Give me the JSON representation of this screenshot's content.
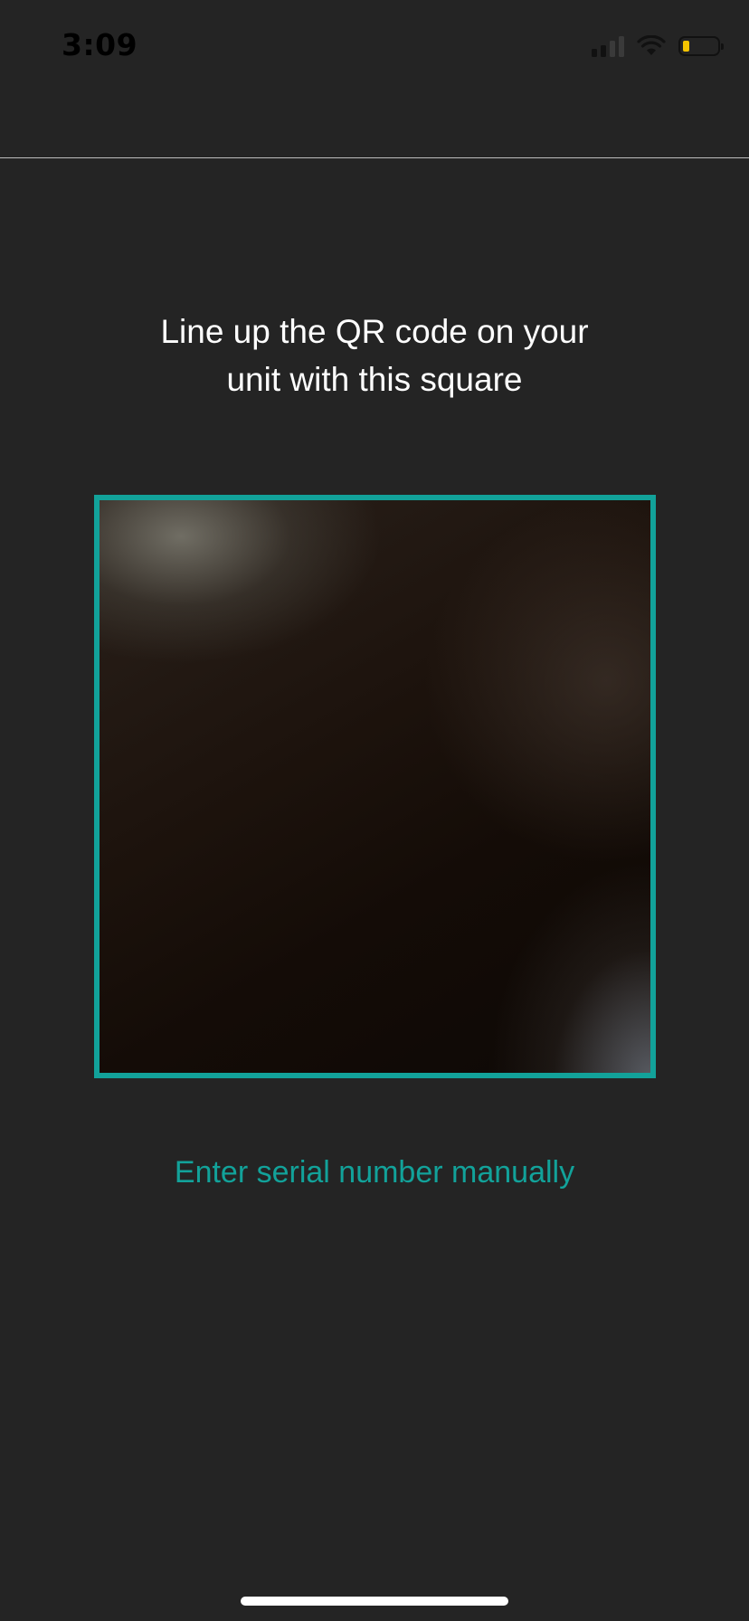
{
  "status_bar": {
    "time": "3:09",
    "signal_bars_active": 2,
    "signal_bars_total": 4,
    "battery_level": 0.2,
    "battery_color": "#f5c400"
  },
  "scanner": {
    "instruction_line1": "Line up the QR code on your",
    "instruction_line2": "unit with this square",
    "frame_color": "#12a29a"
  },
  "actions": {
    "manual_entry_label": "Enter serial number manually"
  },
  "icons": {
    "signal": "cellular-signal-icon",
    "wifi": "wifi-icon",
    "battery": "battery-icon"
  }
}
